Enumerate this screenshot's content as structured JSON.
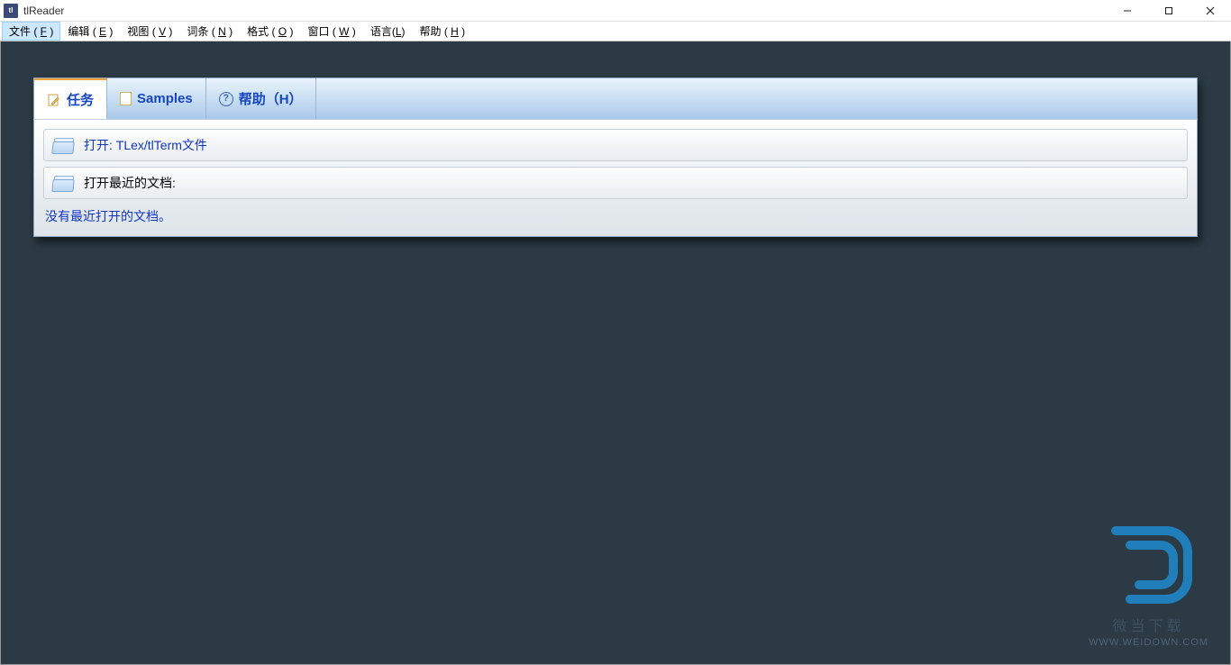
{
  "window": {
    "title": "tlReader"
  },
  "menu": {
    "items": [
      {
        "pre": "文件 ( ",
        "ul": "F",
        "post": " )",
        "active": true
      },
      {
        "pre": "编辑 ( ",
        "ul": "E",
        "post": " )",
        "active": false
      },
      {
        "pre": "视图 ( ",
        "ul": "V",
        "post": " )",
        "active": false
      },
      {
        "pre": "词条 ( ",
        "ul": "N",
        "post": " )",
        "active": false
      },
      {
        "pre": "格式 ( ",
        "ul": "O",
        "post": " )",
        "active": false
      },
      {
        "pre": "窗口 ( ",
        "ul": "W",
        "post": " )",
        "active": false
      },
      {
        "pre": "语言(",
        "ul": "L",
        "post": ")",
        "active": false
      },
      {
        "pre": "帮助 ( ",
        "ul": "H",
        "post": " )",
        "active": false
      }
    ]
  },
  "tabs": {
    "items": [
      {
        "label": "任务",
        "icon": "edit",
        "active": true
      },
      {
        "label": "Samples",
        "icon": "doc",
        "active": false
      },
      {
        "label": "帮助（H）",
        "icon": "help",
        "active": false
      }
    ]
  },
  "panel": {
    "open_label": "打开: TLex/tlTerm文件",
    "recent_label": "打开最近的文档:",
    "recent_empty": "没有最近打开的文档。"
  },
  "watermark": {
    "line1": "微当下载",
    "line2": "WWW.WEIDOWN.COM"
  }
}
